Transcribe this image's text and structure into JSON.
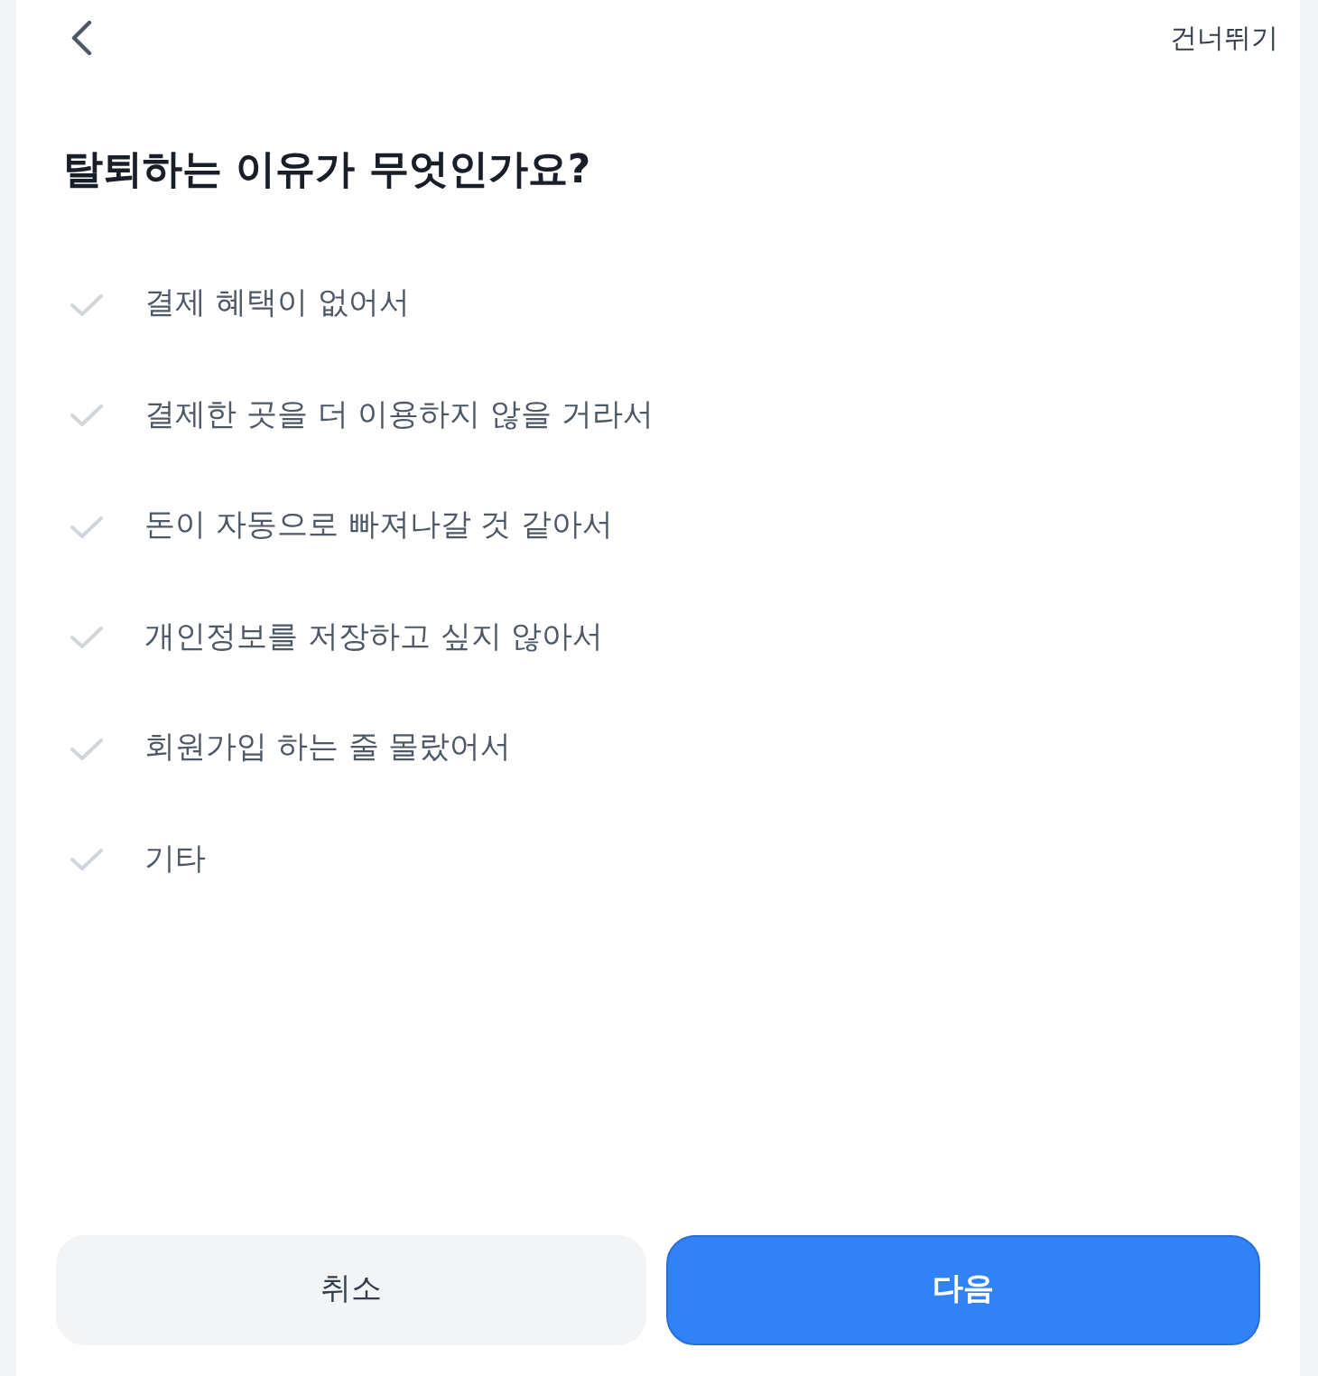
{
  "header": {
    "skip_link": "건너뛰기"
  },
  "title": "탈퇴하는 이유가 무엇인가요?",
  "options": [
    {
      "label": "결제 혜택이 없어서",
      "checked": false
    },
    {
      "label": "결제한 곳을 더 이용하지 않을 거라서",
      "checked": false
    },
    {
      "label": "돈이 자동으로 빠져나갈 것 같아서",
      "checked": false
    },
    {
      "label": "개인정보를 저장하고 싶지 않아서",
      "checked": false
    },
    {
      "label": "회원가입 하는 줄 몰랐어서",
      "checked": false
    },
    {
      "label": "기타",
      "checked": false
    }
  ],
  "buttons": [
    {
      "kind": "secondary",
      "label": "취소"
    },
    {
      "kind": "primary",
      "label": "다음"
    }
  ]
}
